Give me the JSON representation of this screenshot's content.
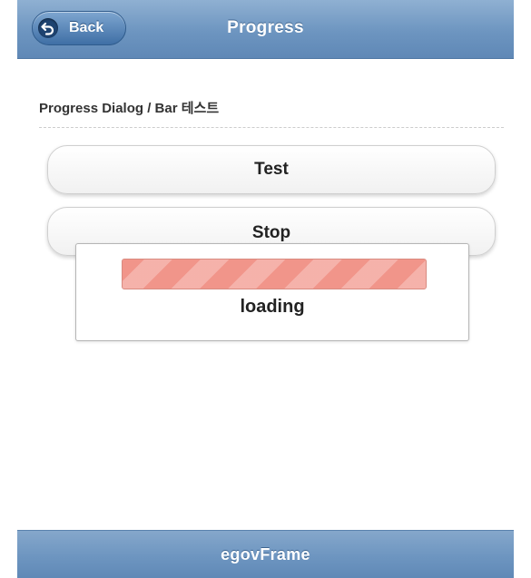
{
  "header": {
    "title": "Progress",
    "back_label": "Back",
    "back_icon": "undo-arrow-icon"
  },
  "content": {
    "section_title": "Progress Dialog / Bar 테스트",
    "buttons": {
      "test_label": "Test",
      "stop_label": "Stop"
    }
  },
  "dialog": {
    "progress_value": 1.0,
    "loading_label": "loading",
    "bar_color": "#f1958a"
  },
  "footer": {
    "label": "egovFrame"
  },
  "colors": {
    "header_bar": "#6d95c0",
    "back_button": "#3f6fa5",
    "button_background": "#ffffff"
  }
}
